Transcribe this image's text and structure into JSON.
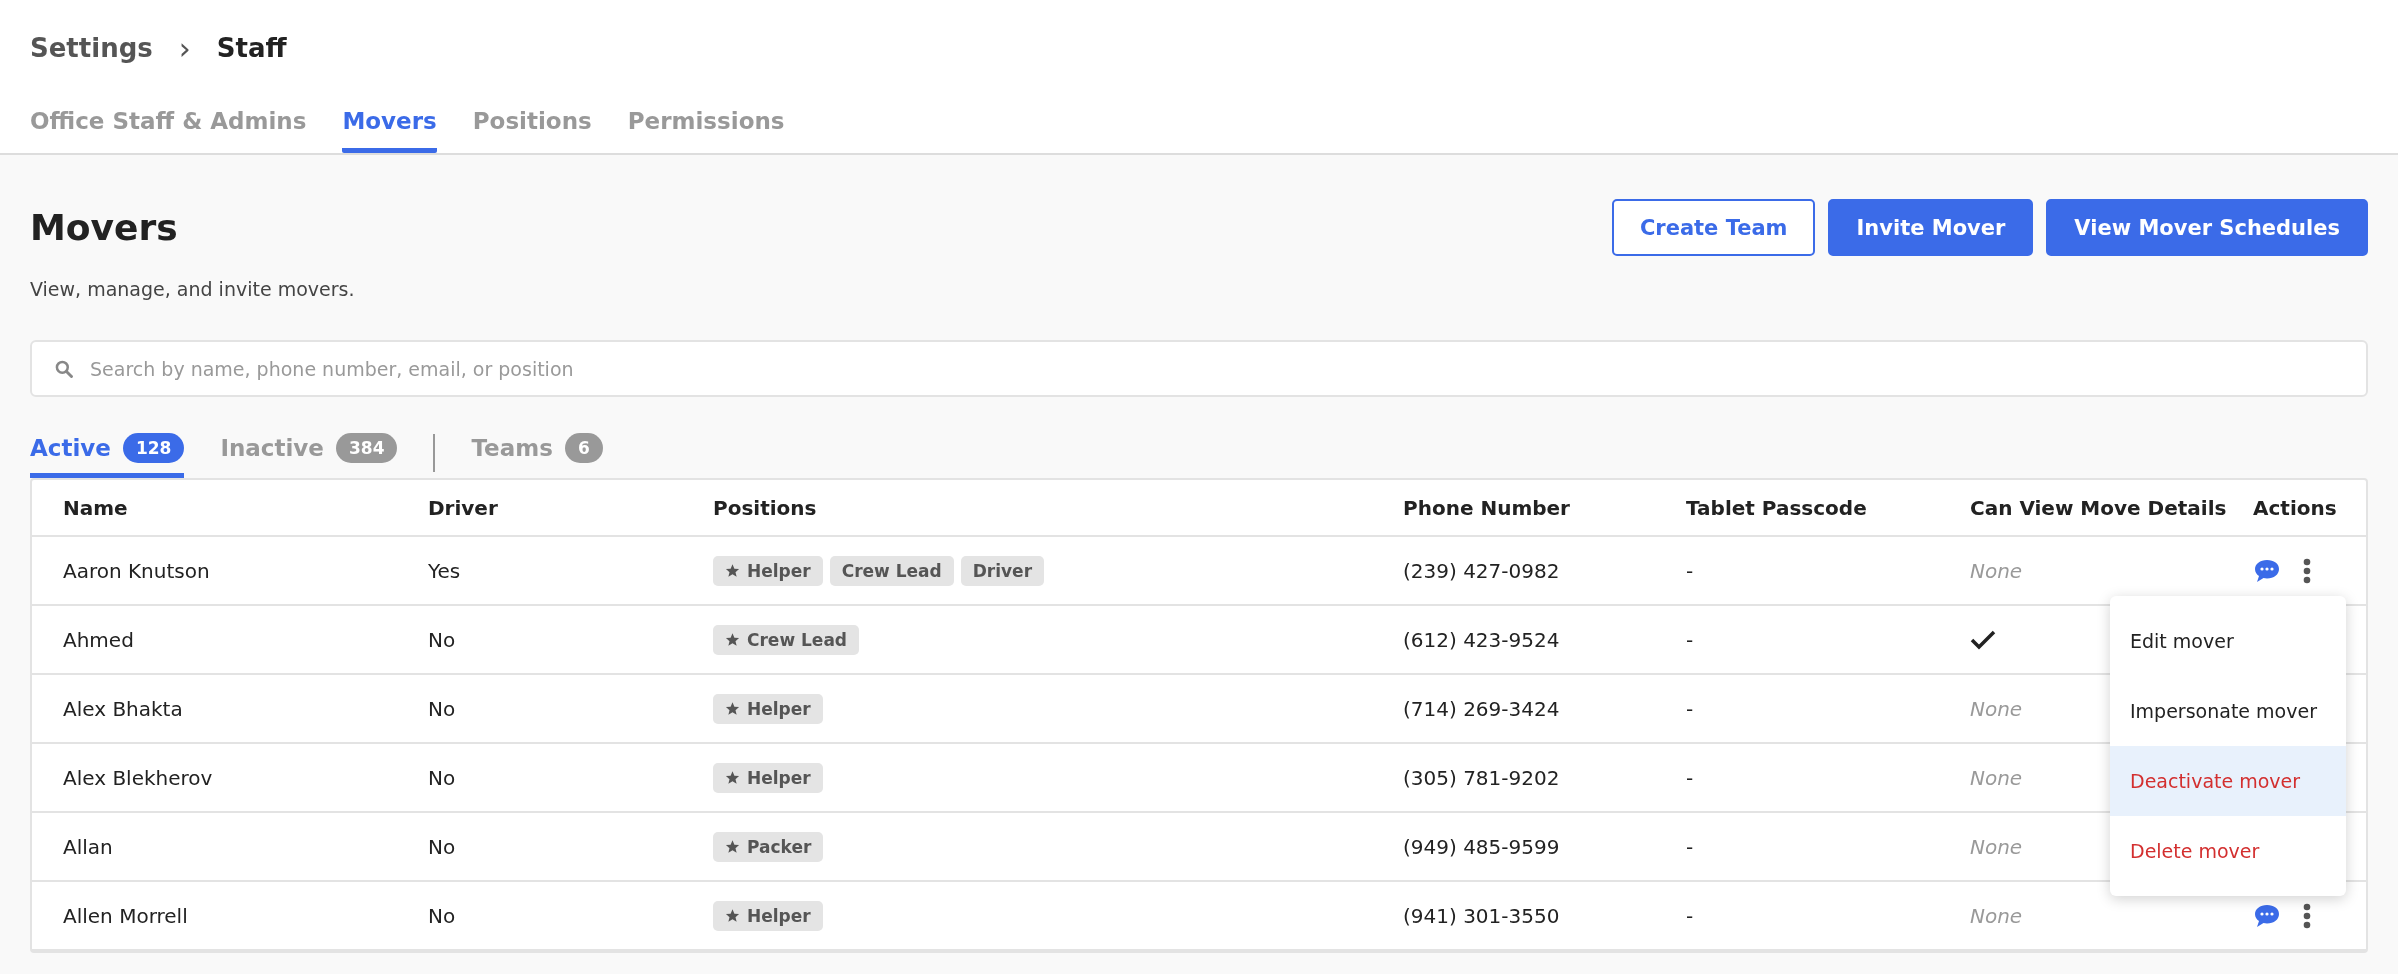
{
  "breadcrumb": {
    "parent": "Settings",
    "separator": "›",
    "current": "Staff"
  },
  "tabs": [
    {
      "label": "Office Staff & Admins",
      "selected": false
    },
    {
      "label": "Movers",
      "selected": true
    },
    {
      "label": "Positions",
      "selected": false
    },
    {
      "label": "Permissions",
      "selected": false
    }
  ],
  "page": {
    "title": "Movers",
    "subtitle": "View, manage, and invite movers."
  },
  "buttons": [
    {
      "label": "Create Team",
      "kind": "outline"
    },
    {
      "label": "Invite Mover",
      "kind": "primary"
    },
    {
      "label": "View Mover Schedules",
      "kind": "primary"
    }
  ],
  "search": {
    "placeholder": "Search by name, phone number, email, or position"
  },
  "status_tabs": [
    {
      "label": "Active",
      "count": "128",
      "selected": true
    },
    {
      "label": "Inactive",
      "count": "384",
      "selected": false
    },
    {
      "label": "Teams",
      "count": "6",
      "selected": false
    }
  ],
  "table": {
    "columns": [
      "Name",
      "Driver",
      "Positions",
      "Phone Number",
      "Tablet Passcode",
      "Can View Move Details",
      "Actions"
    ],
    "rows": [
      {
        "name": "Aaron Knutson",
        "driver": "Yes",
        "positions": [
          {
            "label": "Helper",
            "starred": true
          },
          {
            "label": "Crew Lead",
            "starred": false
          },
          {
            "label": "Driver",
            "starred": false
          }
        ],
        "phone": "(239) 427-0982",
        "passcode": "-",
        "can_view": {
          "checked": false,
          "label": "None"
        }
      },
      {
        "name": "Ahmed",
        "driver": "No",
        "positions": [
          {
            "label": "Crew Lead",
            "starred": true
          }
        ],
        "phone": "(612) 423-9524",
        "passcode": "-",
        "can_view": {
          "checked": true
        }
      },
      {
        "name": "Alex Bhakta",
        "driver": "No",
        "positions": [
          {
            "label": "Helper",
            "starred": true
          }
        ],
        "phone": "(714) 269-3424",
        "passcode": "-",
        "can_view": {
          "checked": false,
          "label": "None"
        }
      },
      {
        "name": "Alex Blekherov",
        "driver": "No",
        "positions": [
          {
            "label": "Helper",
            "starred": true
          }
        ],
        "phone": "(305) 781-9202",
        "passcode": "-",
        "can_view": {
          "checked": false,
          "label": "None"
        }
      },
      {
        "name": "Allan",
        "driver": "No",
        "positions": [
          {
            "label": "Packer",
            "starred": true
          }
        ],
        "phone": "(949) 485-9599",
        "passcode": "-",
        "can_view": {
          "checked": false,
          "label": "None"
        }
      },
      {
        "name": "Allen Morrell",
        "driver": "No",
        "positions": [
          {
            "label": "Helper",
            "starred": true
          }
        ],
        "phone": "(941) 301-3550",
        "passcode": "-",
        "can_view": {
          "checked": false,
          "label": "None"
        }
      }
    ]
  },
  "actions_menu": {
    "items": [
      {
        "label": "Edit mover",
        "kind": "normal",
        "selected": false
      },
      {
        "label": "Impersonate mover",
        "kind": "normal",
        "selected": false
      },
      {
        "label": "Deactivate mover",
        "kind": "danger",
        "selected": true
      },
      {
        "label": "Delete mover",
        "kind": "danger",
        "selected": false
      }
    ]
  }
}
